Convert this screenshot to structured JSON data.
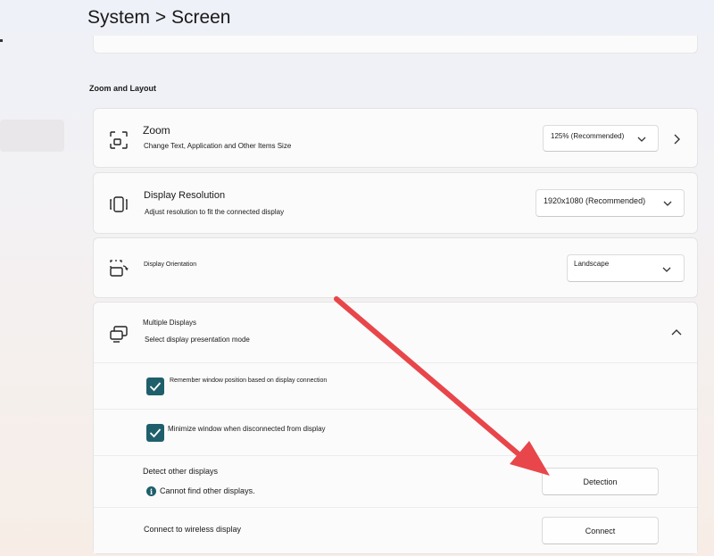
{
  "header": {
    "title": "System > Screen"
  },
  "section": {
    "title": "Zoom and Layout"
  },
  "zoom": {
    "title": "Zoom",
    "subtitle": "Change Text, Application and Other Items Size",
    "selected": "125% (Recommended)",
    "icon": "zoom-icon"
  },
  "resolution": {
    "title": "Display Resolution",
    "subtitle": "Adjust resolution to fit the connected display",
    "selected": "1920x1080 (Recommended)",
    "icon": "resolution-icon"
  },
  "orientation": {
    "title": "Display Orientation",
    "selected": "Landscape",
    "icon": "orientation-icon"
  },
  "multiple_displays": {
    "title": "Multiple Displays",
    "subtitle": "Select display presentation mode",
    "icon": "multiple-displays-icon",
    "options": [
      {
        "label": "Remember window position based on display connection",
        "checked": true
      },
      {
        "label": "Minimize window when disconnected from display",
        "checked": true
      }
    ],
    "detect": {
      "label": "Detect other displays",
      "status": "Cannot find other displays.",
      "button": "Detection"
    },
    "wireless": {
      "label": "Connect to wireless display",
      "button": "Connect"
    }
  },
  "colors": {
    "accent": "#1f5f6b",
    "annotation": "#e8464a"
  }
}
